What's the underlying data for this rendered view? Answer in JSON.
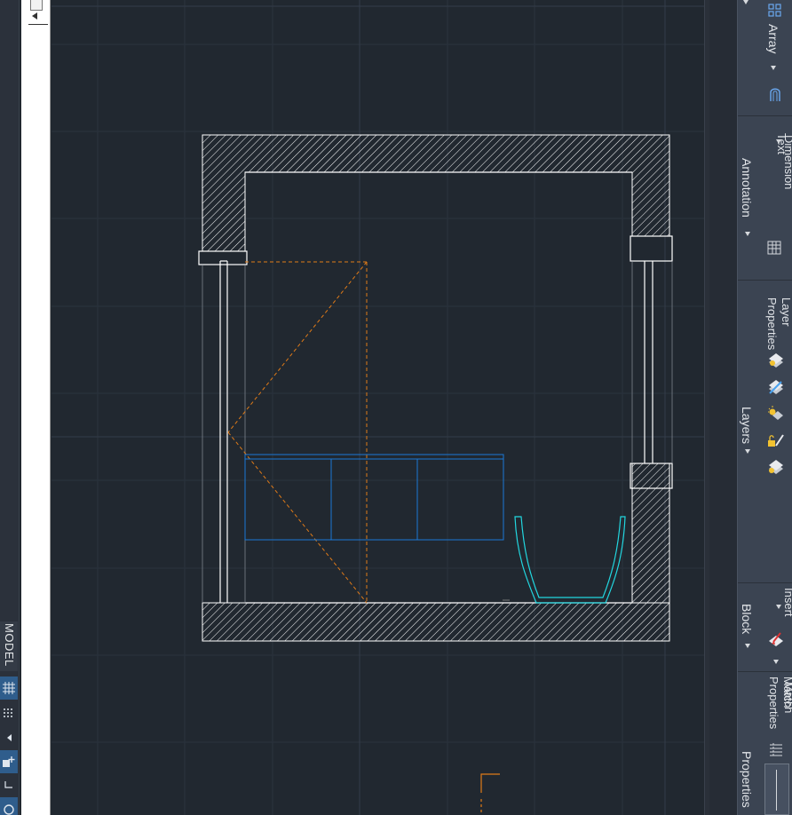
{
  "status_bar": {
    "model_label": "MODEL",
    "buttons": [
      "grid-icon",
      "snap-icon",
      "arrow-left-icon",
      "add-icon",
      "corner-icon",
      "circle-icon"
    ]
  },
  "ribbon": {
    "modify_panel": {
      "array_label": "Array",
      "array_icon": "array-icon",
      "arc_icon": "fillet-icon"
    },
    "annotation_panel": {
      "title": "Annotation",
      "text_label": "Text",
      "dimension_label": "Dimension",
      "table_icon": "table-icon"
    },
    "layers_panel": {
      "title": "Layers",
      "layer_properties_label": "Layer\nProperties",
      "icons": [
        "layer-properties-icon",
        "layer-state-icon",
        "layer-freeze-icon",
        "layer-lock-icon",
        "layer-match-icon"
      ]
    },
    "block_panel": {
      "title": "Block",
      "insert_label": "Insert",
      "insert_icon": "insert-block-icon"
    },
    "properties_panel": {
      "title": "Properties",
      "match_label": "Match",
      "match_properties_label": "Match\nProperties",
      "icon": "match-properties-icon"
    }
  },
  "colors": {
    "canvas_bg": "#212830",
    "wall": "#ffffff",
    "door_swing": "#e07b18",
    "furniture": "#1a78d6",
    "tub": "#22d7e0",
    "grid": "#2c3440"
  }
}
